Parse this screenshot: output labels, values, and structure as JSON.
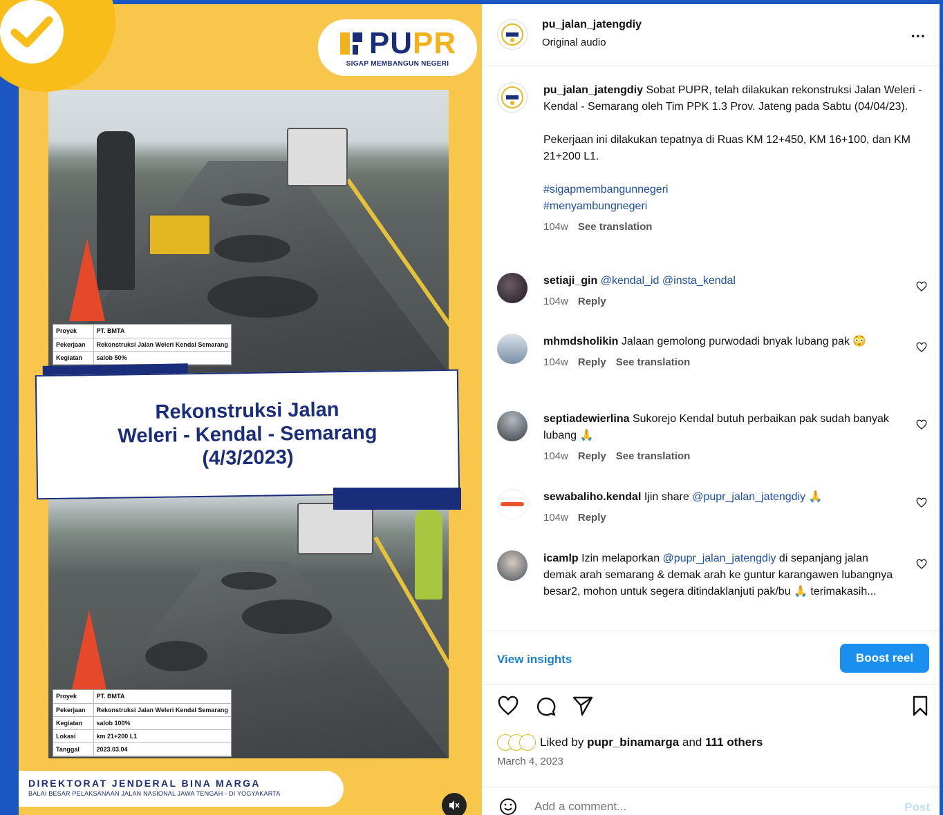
{
  "media": {
    "logo_word_1": "PU",
    "logo_word_2": "PR",
    "logo_tagline": "SIGAP MEMBANGUN NEGERI",
    "table_top": [
      {
        "k": "Proyek",
        "v": "PT. BMTA"
      },
      {
        "k": "Pekerjaan",
        "v": "Rekonstruksi Jalan Weleri Kendal Semarang"
      },
      {
        "k": "Kegiatan",
        "v": "salob 50%"
      }
    ],
    "title_line_1": "Rekonstruksi Jalan",
    "title_line_2": "Weleri - Kendal - Semarang",
    "title_line_3": "(4/3/2023)",
    "table_bottom": [
      {
        "k": "Proyek",
        "v": "PT. BMTA"
      },
      {
        "k": "Pekerjaan",
        "v": "Rekonstruksi Jalan Weleri Kendal Semarang"
      },
      {
        "k": "Kegiatan",
        "v": "salob 100%"
      },
      {
        "k": "Lokasi",
        "v": "km 21+200 L1"
      },
      {
        "k": "Tanggal",
        "v": "2023.03.04"
      }
    ],
    "footer_line_1": "DIREKTORAT JENDERAL BINA MARGA",
    "footer_line_2": "BALAI BESAR PELAKSANAAN JALAN NASIONAL JAWA TENGAH - DI YOGYAKARTA"
  },
  "header": {
    "username": "pu_jalan_jatengdiy",
    "audio": "Original audio",
    "more": "..."
  },
  "caption": {
    "username": "pu_jalan_jatengdiy",
    "text_1": "Sobat PUPR, telah dilakukan rekonstruksi Jalan Weleri - Kendal - Semarang oleh Tim PPK 1.3 Prov. Jateng pada Sabtu (04/04/23).",
    "text_2": "Pekerjaan ini dilakukan tepatnya di Ruas KM 12+450, KM 16+100, dan KM 21+200 L1.",
    "hashtag_1": "#sigapmembangunnegeri",
    "hashtag_2": "#menyambungnegeri",
    "time": "104w",
    "see_translation": "See translation"
  },
  "comments": [
    {
      "username": "setiaji_gin",
      "text": "",
      "mentions": "@kendal_id @insta_kendal",
      "emoji": "",
      "time": "104w",
      "reply": "Reply",
      "translation": ""
    },
    {
      "username": "mhmdsholikin",
      "text": "Jalaan gemolong purwodadi bnyak lubang pak",
      "mentions": "",
      "emoji": "😳",
      "time": "104w",
      "reply": "Reply",
      "translation": "See translation"
    },
    {
      "username": "septiadewierlina",
      "text": "Sukorejo Kendal butuh perbaikan pak sudah banyak lubang",
      "mentions": "",
      "emoji": "🙏",
      "time": "104w",
      "reply": "Reply",
      "translation": "See translation"
    },
    {
      "username": "sewabaliho.kendal",
      "text": "Ijin share",
      "mentions": "@pupr_jalan_jatengdiy",
      "emoji": "🙏",
      "time": "104w",
      "reply": "Reply",
      "translation": ""
    },
    {
      "username": "icamlp",
      "text_before": "Izin melaporkan",
      "mention": "@pupr_jalan_jatengdiy",
      "text_after": "di sepanjang jalan demak arah semarang & demak arah ke guntur karangawen lubangnya besar2, mohon untuk segera ditindaklanjuti pak/bu",
      "emoji": "🙏",
      "tail": "terimakasih..."
    }
  ],
  "insights": {
    "view": "View insights",
    "boost": "Boost reel"
  },
  "likes": {
    "prefix": "Liked by",
    "user": "pupr_binamarga",
    "middle": "and",
    "others": "111 others"
  },
  "date": "March 4, 2023",
  "add_comment": {
    "placeholder": "Add a comment...",
    "post": "Post"
  },
  "colors": {
    "background": "#1b57c2",
    "media_yellow": "#f7c64a",
    "navy": "#1a2d7a",
    "link": "#1d4ea8",
    "boost": "#1a8ff0"
  }
}
